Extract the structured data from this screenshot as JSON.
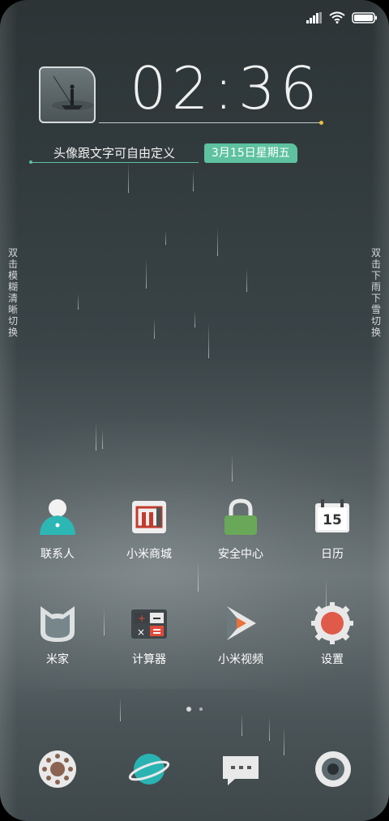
{
  "status_bar": {
    "icons": [
      "signal-icon",
      "wifi-icon",
      "battery-icon"
    ]
  },
  "widget": {
    "time": "02:36",
    "tagline": "头像跟文字可自由定义",
    "date": "3月15日星期五",
    "accent_color": "#5ec19f"
  },
  "side_hints": {
    "left": "双击模糊清晰切换",
    "right": "双击下雨下雪切换"
  },
  "apps_row1": [
    {
      "label": "联系人",
      "icon": "contacts-icon"
    },
    {
      "label": "小米商城",
      "icon": "mi-store-icon"
    },
    {
      "label": "安全中心",
      "icon": "lock-icon"
    },
    {
      "label": "日历",
      "icon": "calendar-icon",
      "day": "15"
    }
  ],
  "apps_row2": [
    {
      "label": "米家",
      "icon": "mijia-icon"
    },
    {
      "label": "计算器",
      "icon": "calculator-icon"
    },
    {
      "label": "小米视频",
      "icon": "video-play-icon"
    },
    {
      "label": "设置",
      "icon": "gear-icon"
    }
  ],
  "pager": {
    "pages": 2,
    "active": 1
  },
  "dock": [
    {
      "icon": "phone-dialer-icon"
    },
    {
      "icon": "browser-planet-icon"
    },
    {
      "icon": "messages-icon"
    },
    {
      "icon": "camera-icon"
    }
  ]
}
